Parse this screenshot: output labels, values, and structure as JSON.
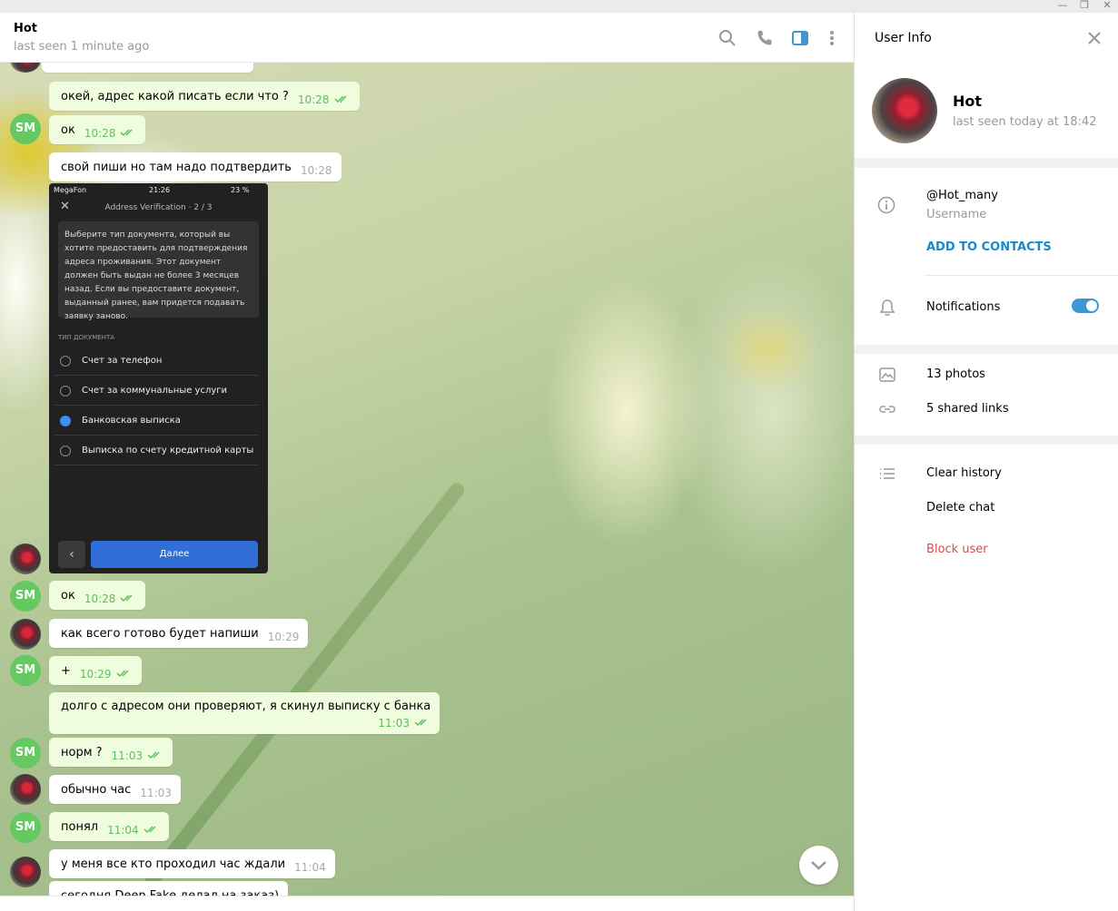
{
  "window": {
    "minimize": "—",
    "maximize": "❐",
    "close": "✕"
  },
  "chat_header": {
    "name": "Hot",
    "status": "last seen 1 minute ago"
  },
  "messages": [
    {
      "text": "окей, адрес какой писать если что ?",
      "time": "10:28",
      "out": true
    },
    {
      "text": "ок",
      "time": "10:28",
      "out": true,
      "avatar": "SM"
    },
    {
      "text": "свой пиши но там надо подтвердить",
      "time": "10:28",
      "out": false
    },
    {
      "text": "ок",
      "time": "10:28",
      "out": true,
      "avatar": "SM"
    },
    {
      "text": "как всего готово будет напиши",
      "time": "10:29",
      "out": false
    },
    {
      "text": "+",
      "time": "10:29",
      "out": true,
      "avatar": "SM"
    },
    {
      "text": "долго с адресом они проверяют, я скинул выписку с банка",
      "time": "11:03",
      "out": true
    },
    {
      "text": "норм ?",
      "time": "11:03",
      "out": true,
      "avatar": "SM"
    },
    {
      "text": "обычно час",
      "time": "11:03",
      "out": false
    },
    {
      "text": "понял",
      "time": "11:04",
      "out": true,
      "avatar": "SM"
    },
    {
      "text": "у меня все кто проходил час ждали",
      "time": "11:04",
      "out": false
    },
    {
      "text": "сегодня Deep Fake делал на заказ)",
      "time": "",
      "out": false
    }
  ],
  "phone_screenshot": {
    "carrier": "MegaFon",
    "clock": "21:26",
    "battery": "23 %",
    "title": "Address Verification · 2 / 3",
    "description": "Выберите тип документа, который вы хотите предоставить для подтверждения адреса проживания. Этот документ должен быть выдан не более 3 месяцев назад. Если вы предоставите документ, выданный ранее, вам придется подавать заявку заново.",
    "section_label": "ТИП ДОКУМЕНТА",
    "options": [
      "Счет за телефон",
      "Счет за коммунальные услуги",
      "Банковская выписка",
      "Выписка по счету кредитной карты"
    ],
    "selected_option": "Банковская выписка",
    "next_button": "Далее"
  },
  "user_info": {
    "title": "User Info",
    "name": "Hot",
    "status": "last seen today at 18:42",
    "username": "@Hot_many",
    "username_label": "Username",
    "add_contacts": "ADD TO CONTACTS",
    "notifications": "Notifications",
    "notifications_on": true,
    "photos": "13 photos",
    "links": "5 shared links",
    "clear_history": "Clear history",
    "delete_chat": "Delete chat",
    "block_user": "Block user"
  },
  "colors": {
    "accent": "#3f96d0",
    "outgoing_bubble": "#effdde",
    "read_ticks": "#5dbf5f",
    "danger": "#d14e4e",
    "link": "#168acd"
  }
}
